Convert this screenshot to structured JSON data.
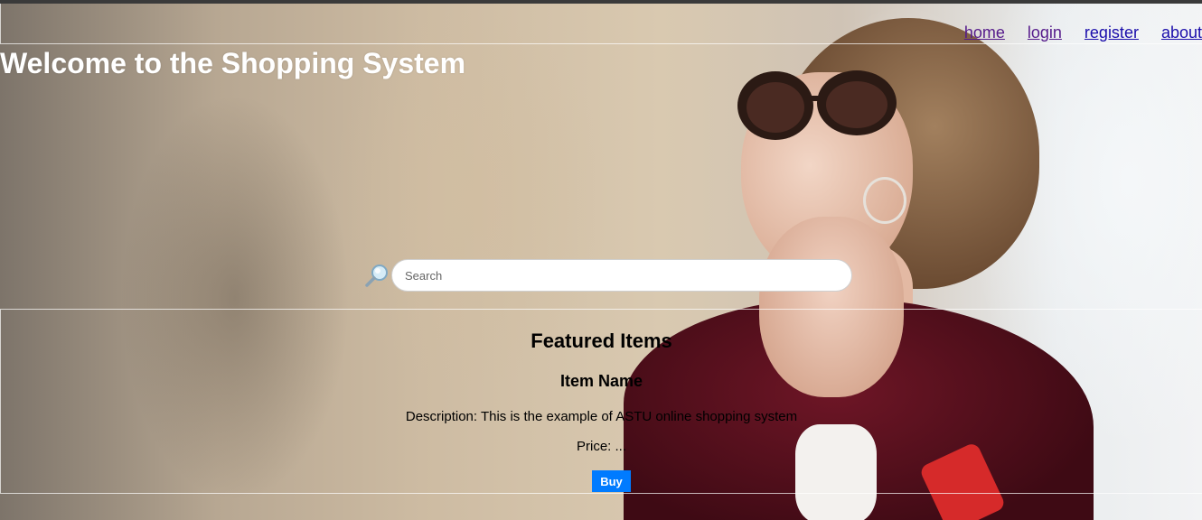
{
  "header": {
    "title": "Welcome to the Shopping System",
    "nav": [
      {
        "label": "home"
      },
      {
        "label": "login"
      },
      {
        "label": "register"
      },
      {
        "label": "about"
      }
    ]
  },
  "search": {
    "placeholder": "Search",
    "value": "",
    "icon": "magnifier-icon"
  },
  "featured": {
    "heading": "Featured Items",
    "item": {
      "name": "Item Name",
      "description": "Description: This is the example of ASTU online shopping system",
      "price": "Price: ...",
      "buy_label": "Buy"
    }
  },
  "colors": {
    "link": "#1a0dab",
    "link_visited": "#551a8b",
    "title": "#ffffff",
    "buy_button": "#007bff"
  }
}
